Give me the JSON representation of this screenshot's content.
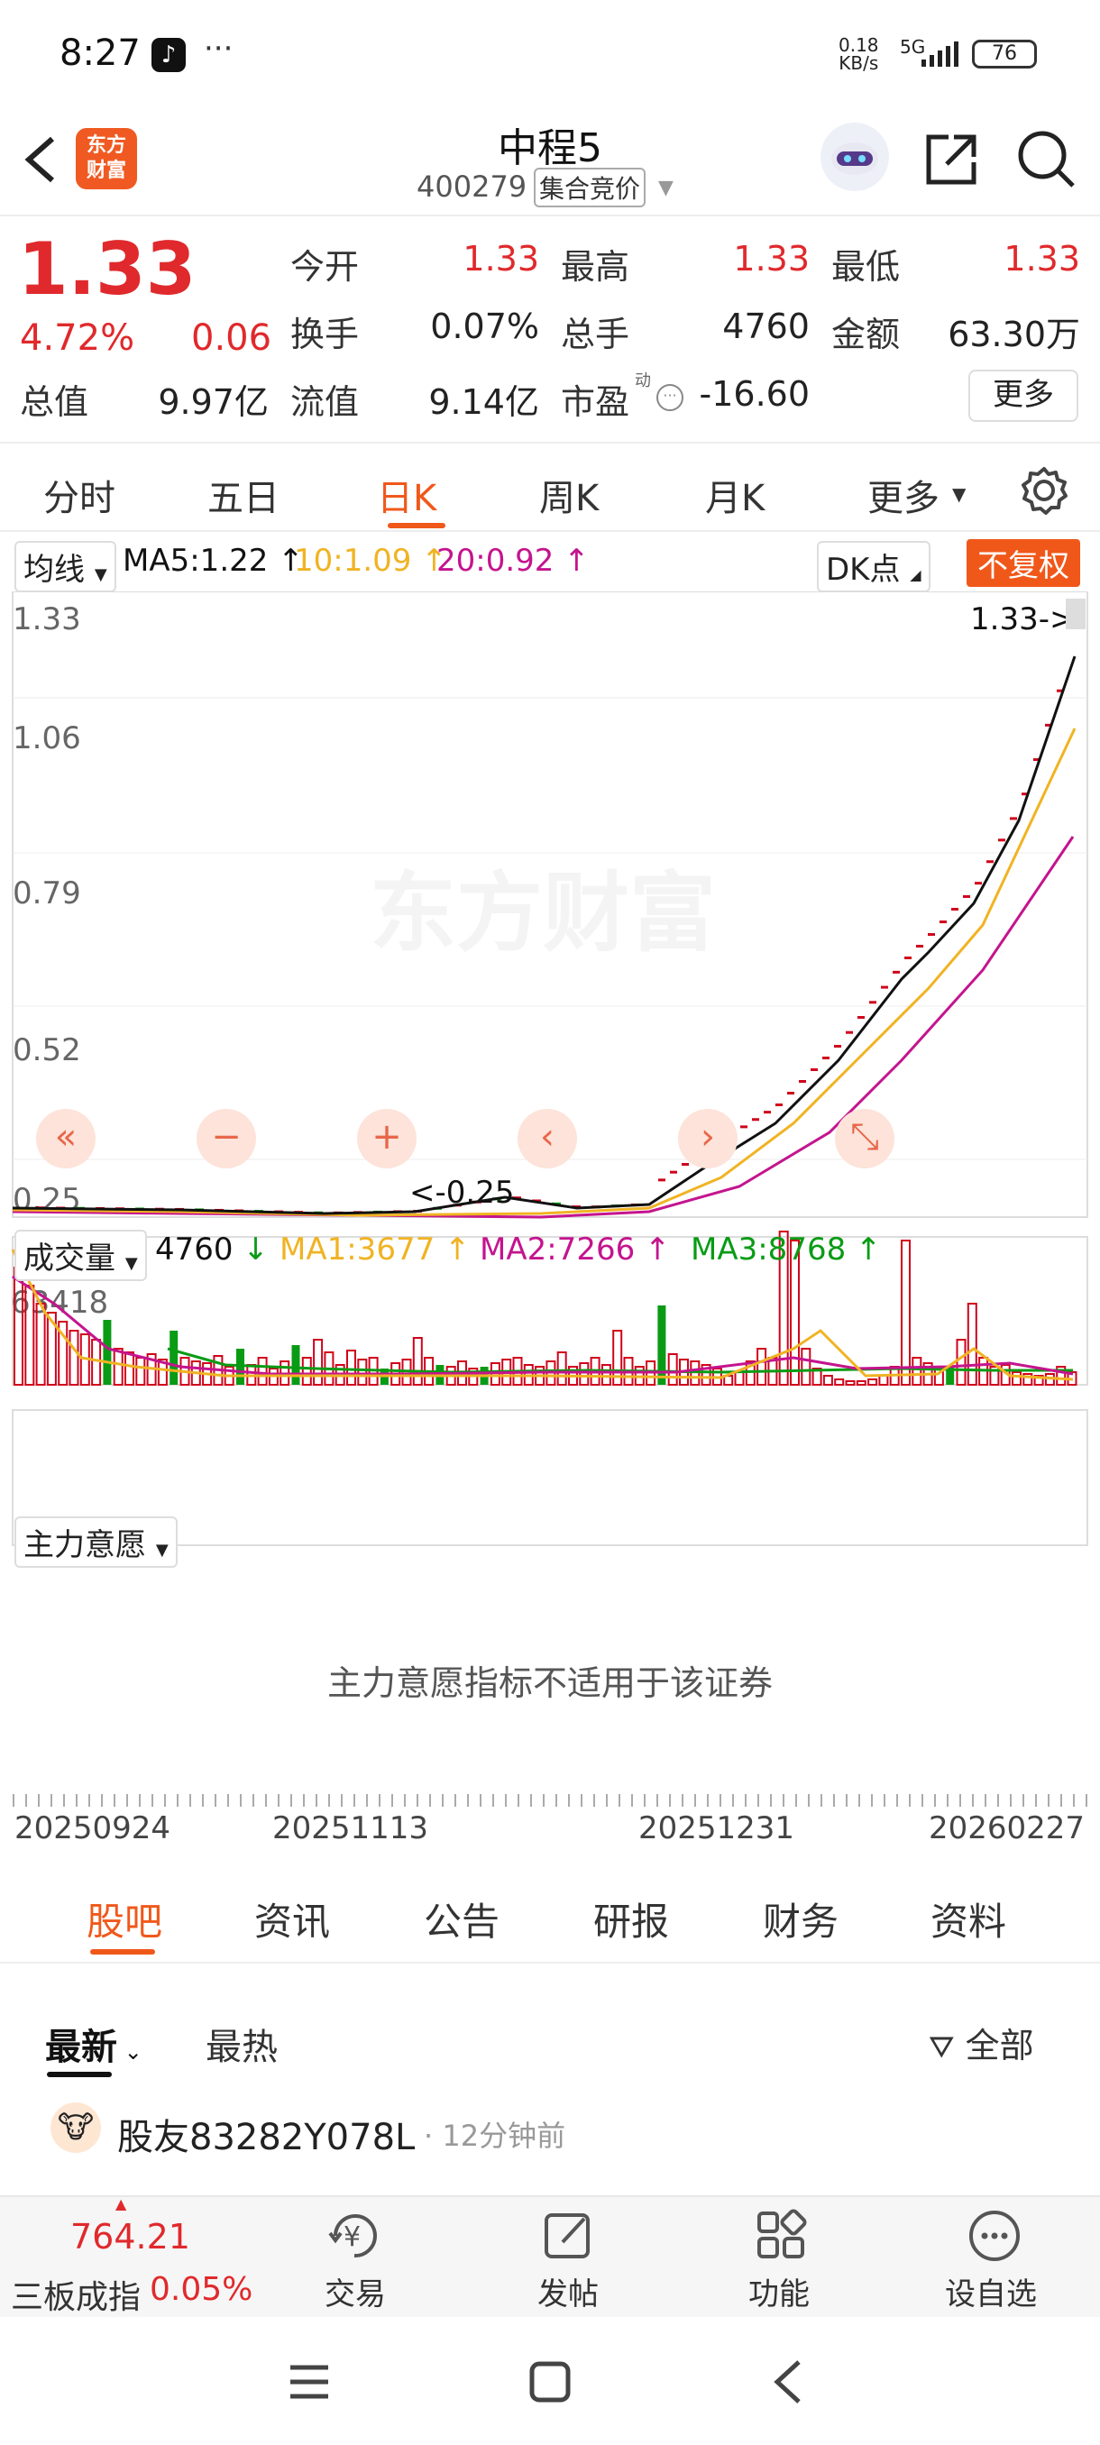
{
  "status": {
    "time": "8:27",
    "dots": "···",
    "speed_top": "0.18",
    "speed_bottom": "KB/s",
    "network": "5G",
    "battery": "76"
  },
  "header": {
    "logo_text_top": "东方",
    "logo_text_bottom": "财富",
    "stock_name": "中程5",
    "stock_code": "400279",
    "auction_badge": "集合竞价"
  },
  "quote": {
    "price": "1.33",
    "pct": "4.72%",
    "change": "0.06",
    "rows": [
      [
        {
          "label": "今开",
          "value": "1.33",
          "red": true
        },
        {
          "label": "最高",
          "value": "1.33",
          "red": true
        },
        {
          "label": "最低",
          "value": "1.33",
          "red": true
        }
      ],
      [
        {
          "label": "换手",
          "value": "0.07%",
          "red": false
        },
        {
          "label": "总手",
          "value": "4760",
          "red": false
        },
        {
          "label": "金额",
          "value": "63.30万",
          "red": false
        }
      ],
      [
        {
          "label": "总值",
          "value": "9.97亿",
          "red": false
        },
        {
          "label": "流值",
          "value": "9.14亿",
          "red": false
        },
        {
          "label": "市盈",
          "value": "-16.60",
          "red": false
        }
      ]
    ],
    "pe_badge": "动",
    "more_button": "更多"
  },
  "tabs": [
    "分时",
    "五日",
    "日K",
    "周K",
    "月K",
    "更多"
  ],
  "active_tab": "日K",
  "chart": {
    "ma_selector": "均线",
    "ma5": "MA5:1.22",
    "ma10": "10:1.09",
    "ma20": "20:0.92",
    "dk_button": "DK点",
    "fq_button": "不复权",
    "watermark": "东方财富",
    "price_label": "1.33->",
    "low_label": "<-0.25",
    "volume_selector": "成交量",
    "volume_value": "4760",
    "vma1": "MA1:3677",
    "vma2": "MA2:7266",
    "vma3": "MA3:8768",
    "volume_max": "63418",
    "indicator_selector": "主力意愿",
    "indicator_message": "主力意愿指标不适用于该证券",
    "dates": [
      "20250924",
      "20251113",
      "20251231",
      "20260227"
    ],
    "colors": {
      "up": "#d0021b",
      "down": "#0a9b15",
      "ma5": "#111111",
      "ma10": "#f0b323",
      "ma20": "#c4148e",
      "accent": "#f0581a"
    }
  },
  "chart_data": {
    "type": "line",
    "y_ticks": [
      "1.33",
      "1.06",
      "0.79",
      "0.52",
      "0.25"
    ],
    "ylim": [
      0.25,
      1.33
    ],
    "x": [
      "20250924",
      "20251113",
      "20251231",
      "20260227"
    ],
    "series": [
      {
        "name": "MA5",
        "values": [
          0.27,
          0.26,
          0.27,
          0.3,
          0.52,
          1.22
        ]
      },
      {
        "name": "10",
        "values": [
          0.27,
          0.26,
          0.26,
          0.29,
          0.45,
          1.09
        ]
      },
      {
        "name": "20",
        "values": [
          0.27,
          0.27,
          0.26,
          0.27,
          0.38,
          0.92
        ]
      }
    ]
  },
  "news": {
    "tabs": [
      "股吧",
      "资讯",
      "公告",
      "研报",
      "财务",
      "资料"
    ],
    "active": "股吧",
    "sort_latest": "最新",
    "sort_hot": "最热",
    "filter_label": "全部",
    "post_user": "股友83282Y078L",
    "post_time": "· 12分钟前"
  },
  "bottom": {
    "index_value": "764.21",
    "index_name": "三板成指",
    "index_pct": "0.05%",
    "items": [
      {
        "label": "交易",
        "icon": "trade-icon"
      },
      {
        "label": "发帖",
        "icon": "post-icon"
      },
      {
        "label": "功能",
        "icon": "apps-icon"
      },
      {
        "label": "设自选",
        "icon": "favorite-icon"
      }
    ]
  }
}
